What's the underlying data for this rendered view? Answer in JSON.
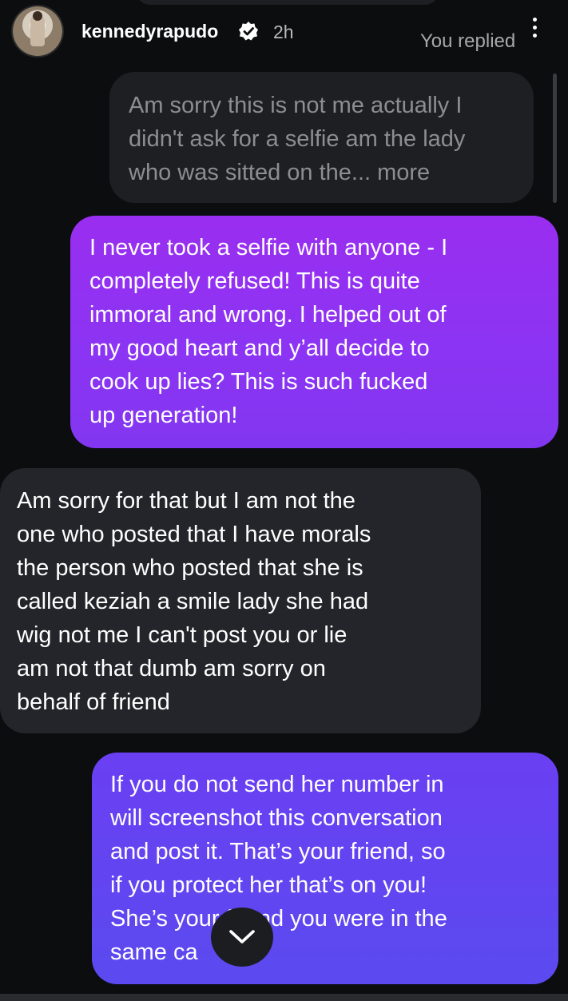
{
  "header": {
    "username": "kennedyrapudo",
    "time": "2h",
    "reply_status": "You replied",
    "icons": [
      "avatar",
      "verified-badge-icon",
      "more-vertical-icon"
    ]
  },
  "messages": [
    {
      "sender": "other",
      "text": "Am sorry this is not me actually I\ndidn't ask for a selfie am the lady\nwho was sitted on the... more"
    },
    {
      "sender": "me",
      "text": "I never took a selfie with anyone - I\ncompletely refused! This is quite\nimmoral and wrong. I helped out of\nmy good heart and y’all decide to\ncook up lies? This is such fucked\nup generation!"
    },
    {
      "sender": "other",
      "text": "Am sorry for that but I am not the\none who posted that I have morals\nthe person who posted that she is\ncalled keziah a smile lady she had\nwig not me I can't post you or lie\nam not that dumb am sorry on\nbehalf of friend"
    },
    {
      "sender": "me",
      "text": "If you do not send her number in\nwill screenshot this conversation\nand post it. That’s your friend, so\nif you protect her that’s on you!\nShe’s your friend you were in the\nsame ca"
    }
  ],
  "colors": {
    "background": "#0c0d0f",
    "incoming_bubble": "#24252a",
    "outgoing_purple": "#8b34f3",
    "outgoing_blue": "#5b4af0"
  }
}
